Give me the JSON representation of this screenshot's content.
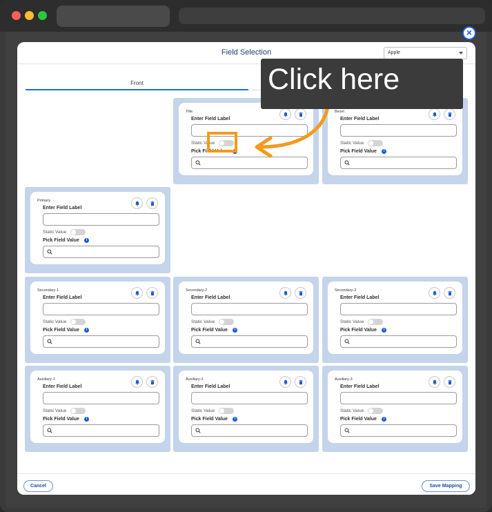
{
  "modal": {
    "title": "Field Selection",
    "close_glyph": "×",
    "dropdown": {
      "value": "Apple"
    }
  },
  "tabs": {
    "front": "Front",
    "back": ""
  },
  "card_text": {
    "enter_label": "Enter Field Label",
    "static_value": "Static Value",
    "pick_value": "Pick Field Value",
    "info_glyph": "i"
  },
  "cards": [
    {
      "name": "Title"
    },
    {
      "name": "Bezel"
    },
    {
      "name": "Primary"
    },
    {
      "name": "Secondary-1"
    },
    {
      "name": "Secondary-2"
    },
    {
      "name": "Secondary-3"
    },
    {
      "name": "Auxiliary-1"
    },
    {
      "name": "Auxiliary-2"
    },
    {
      "name": "Auxiliary-3"
    }
  ],
  "footer": {
    "cancel": "Cancel",
    "save": "Save Mapping"
  },
  "annotation": {
    "text": "Click here"
  },
  "colors": {
    "accent": "#1a5bd6",
    "slot": "#c4d4ea",
    "highlight": "#f39a1e"
  },
  "icons": [
    "bell-icon",
    "trash-icon",
    "search-icon",
    "info-icon",
    "close-icon",
    "chevron-down-icon"
  ]
}
